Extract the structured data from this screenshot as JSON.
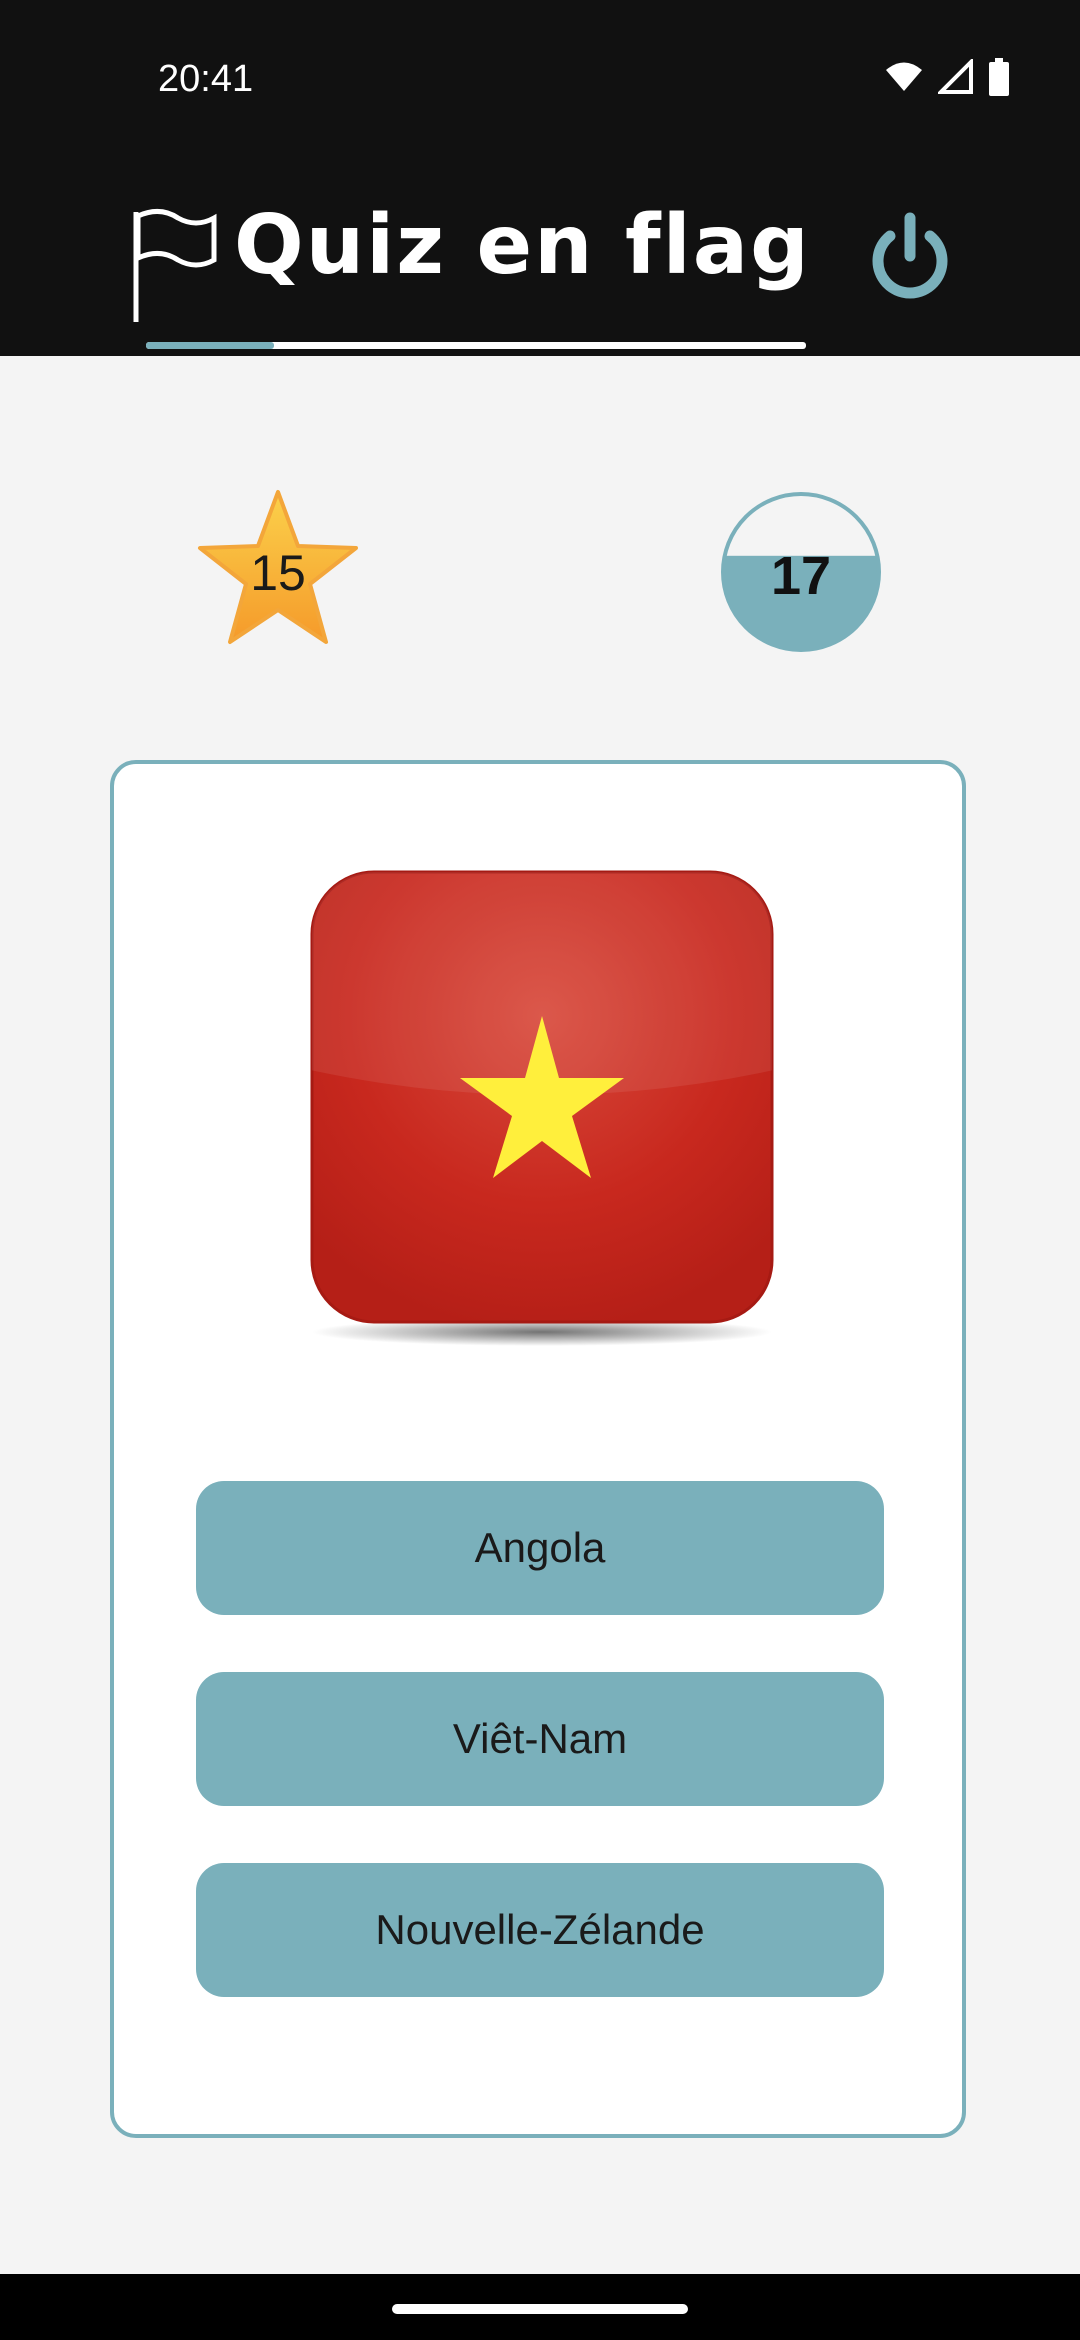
{
  "status_bar": {
    "time": "20:41",
    "icons": [
      "wifi-icon",
      "signal-icon",
      "battery-icon"
    ]
  },
  "header": {
    "logo_text": "Quiz en flag",
    "power_icon": "power-icon"
  },
  "score": {
    "value": "15",
    "icon": "star-icon"
  },
  "timer": {
    "value": "17",
    "remaining_fraction": 0.6
  },
  "question": {
    "flag_icon": "vietnam-flag-icon"
  },
  "answers": [
    {
      "label": "Angola"
    },
    {
      "label": "Viêt-Nam"
    },
    {
      "label": "Nouvelle-Zélande"
    }
  ],
  "colors": {
    "accent": "#7ab0bb",
    "header_bg": "#111111",
    "page_bg": "#f4f4f4",
    "flag_red": "#c8281e",
    "flag_star": "#ffef3c",
    "score_star": "#f7b733"
  }
}
